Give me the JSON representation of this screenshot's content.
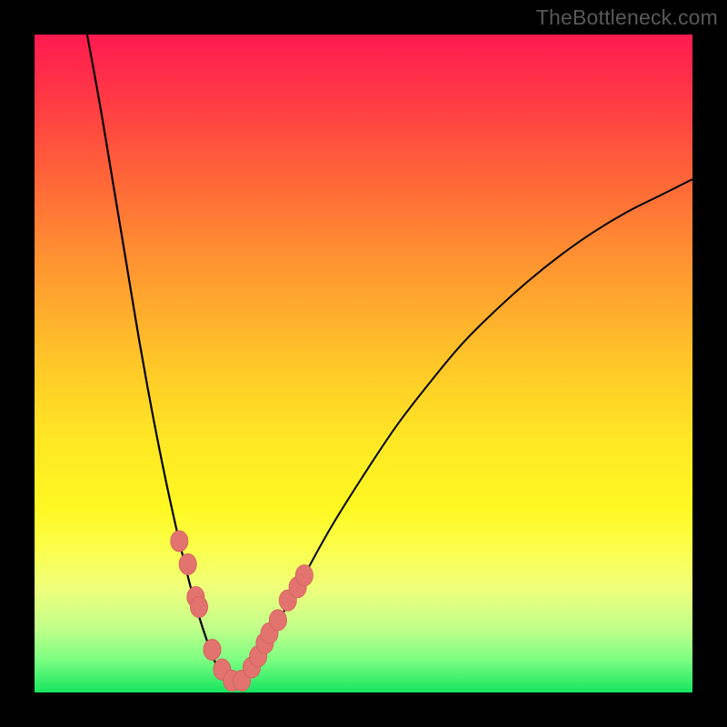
{
  "watermark": "TheBottleneck.com",
  "colors": {
    "frame": "#000000",
    "gradient_stops": [
      {
        "offset": 0.0,
        "color": "#ff1a50"
      },
      {
        "offset": 0.1,
        "color": "#ff3a44"
      },
      {
        "offset": 0.22,
        "color": "#ff6638"
      },
      {
        "offset": 0.36,
        "color": "#ff9930"
      },
      {
        "offset": 0.5,
        "color": "#ffc728"
      },
      {
        "offset": 0.62,
        "color": "#ffe824"
      },
      {
        "offset": 0.72,
        "color": "#fff822"
      },
      {
        "offset": 0.78,
        "color": "#fbff4a"
      },
      {
        "offset": 0.84,
        "color": "#f0ff7a"
      },
      {
        "offset": 0.9,
        "color": "#c4ff8a"
      },
      {
        "offset": 0.95,
        "color": "#7dff82"
      },
      {
        "offset": 1.0,
        "color": "#16e55f"
      }
    ],
    "curve": "#000000",
    "marker_fill": "#e2736f",
    "marker_stroke": "#d8645f"
  },
  "chart_data": {
    "type": "line",
    "title": "",
    "xlabel": "",
    "ylabel": "",
    "xlim": [
      0,
      100
    ],
    "ylim": [
      0,
      100
    ],
    "note": "Axis values are relative (percent of plot width/height). y=0 is the bottom (green), y=100 is the top (red). The curve resembles a bottleneck/mismatch curve with a minimum near x≈30.",
    "series": [
      {
        "name": "curve-left",
        "x": [
          8.0,
          10.0,
          12.0,
          14.0,
          16.0,
          18.0,
          20.0,
          22.0,
          24.0,
          26.0,
          28.0,
          30.0
        ],
        "y": [
          100.0,
          89.0,
          77.0,
          65.0,
          53.0,
          42.0,
          32.0,
          23.0,
          15.0,
          8.5,
          3.5,
          1.5
        ]
      },
      {
        "name": "curve-right",
        "x": [
          30.0,
          33.0,
          36.0,
          40.0,
          45.0,
          50.0,
          55.0,
          60.0,
          65.0,
          70.0,
          75.0,
          80.0,
          85.0,
          90.0,
          95.0,
          100.0
        ],
        "y": [
          1.5,
          4.0,
          9.0,
          16.0,
          25.0,
          33.0,
          40.5,
          47.0,
          53.0,
          58.0,
          62.5,
          66.5,
          70.0,
          73.0,
          75.5,
          78.0
        ]
      },
      {
        "name": "markers",
        "x": [
          22.0,
          23.3,
          24.5,
          25.0,
          27.0,
          28.5,
          30.0,
          31.5,
          33.0,
          34.0,
          35.0,
          35.7,
          37.0,
          38.5,
          40.0,
          41.0
        ],
        "y": [
          23.0,
          19.5,
          14.5,
          13.0,
          6.5,
          3.5,
          1.8,
          1.8,
          3.8,
          5.5,
          7.5,
          9.0,
          11.0,
          14.0,
          16.0,
          17.8
        ]
      }
    ]
  }
}
